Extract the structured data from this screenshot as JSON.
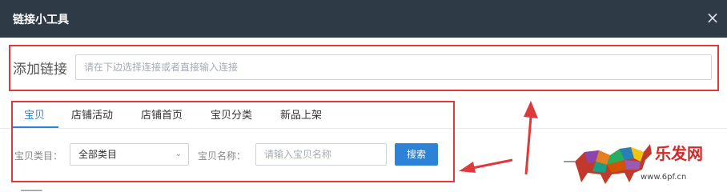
{
  "dialog": {
    "title": "链接小工具",
    "close_icon": "×"
  },
  "add_link": {
    "label": "添加链接",
    "placeholder": "请在下边选择连接或者直接输入连接"
  },
  "tabs": [
    {
      "label": "宝贝",
      "active": true
    },
    {
      "label": "店铺活动",
      "active": false
    },
    {
      "label": "店铺首页",
      "active": false
    },
    {
      "label": "宝贝分类",
      "active": false
    },
    {
      "label": "新品上架",
      "active": false
    }
  ],
  "filters": {
    "category_label": "宝贝类目：",
    "category_value": "全部类目",
    "name_label": "宝贝名称：",
    "name_placeholder": "请输入宝贝名称",
    "search_label": "搜索"
  },
  "watermark": {
    "text": "乐发网",
    "url": "www.6pf.cn"
  },
  "colors": {
    "titlebar": "#2f3a47",
    "accent": "#2b82d6",
    "annotation_red": "#e0393b"
  }
}
